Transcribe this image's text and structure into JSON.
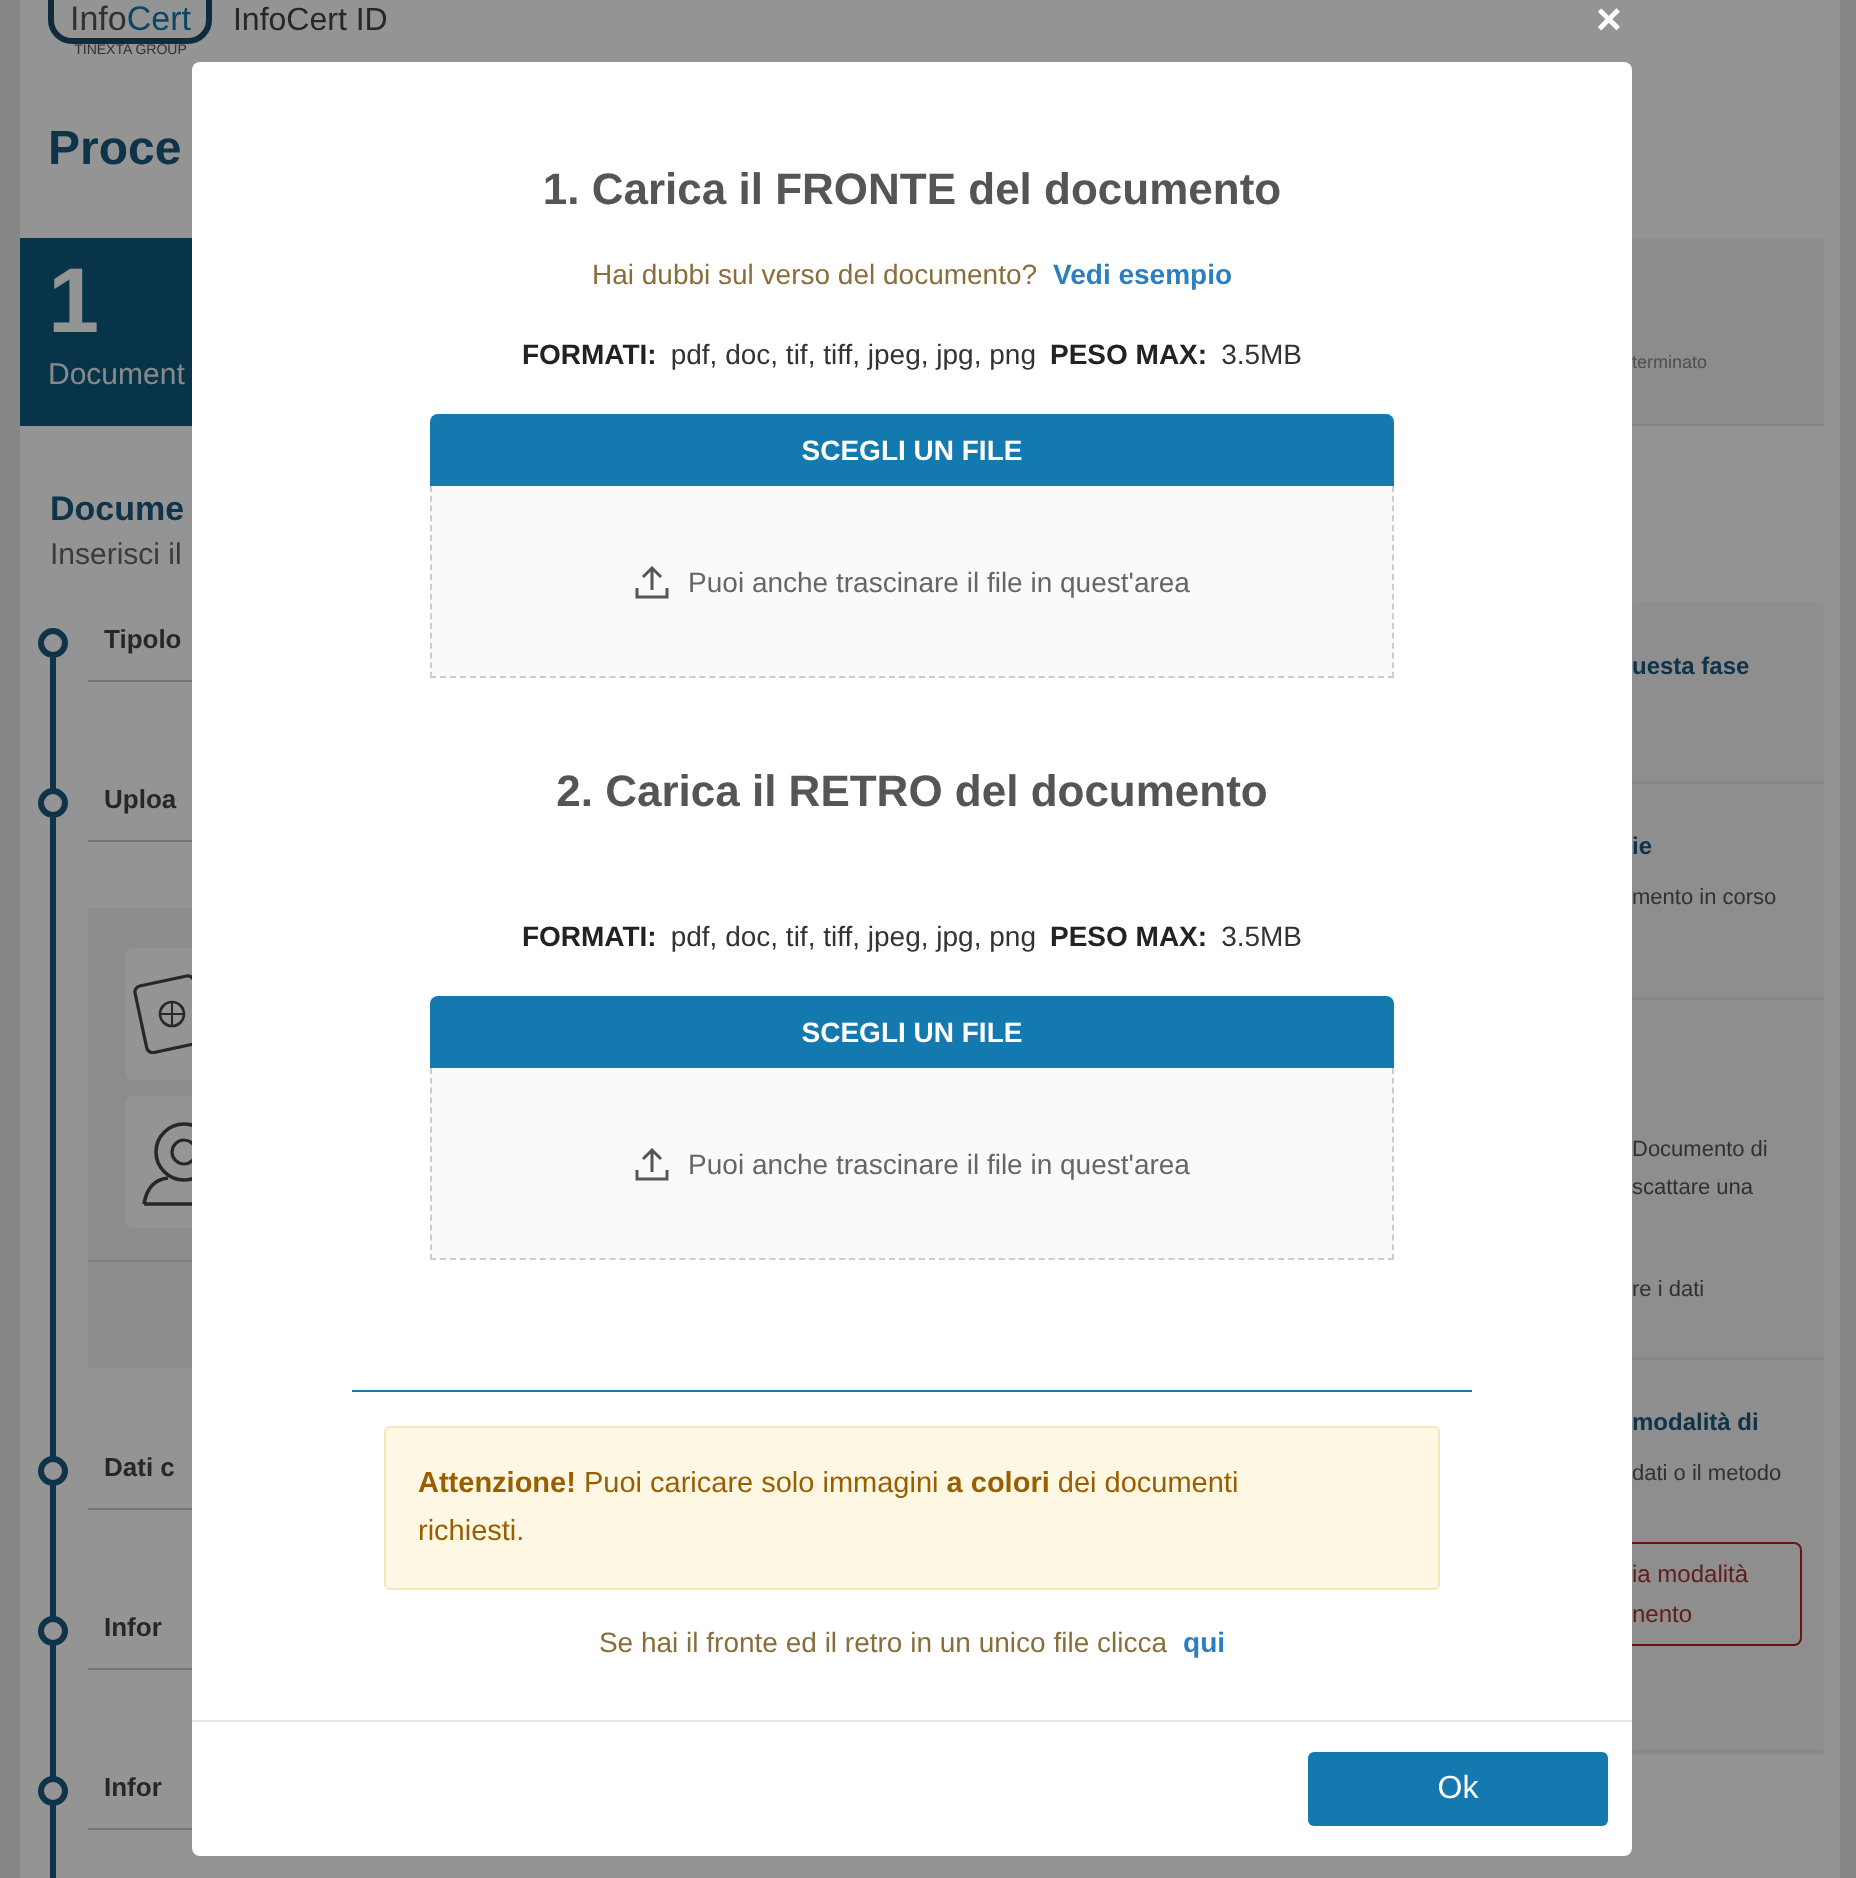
{
  "header": {
    "brand_parts": [
      "Info",
      "Cert"
    ],
    "brand_sub": "TINEXTA GROUP",
    "title": "InfoCert ID"
  },
  "page": {
    "heading": "Proce",
    "step": {
      "number": "1",
      "label": "Document",
      "selected": true
    },
    "step_note": "terminato",
    "section_title": "Docume",
    "section_subtitle": "Inserisci il",
    "timeline_top": [
      {
        "label": "Tipolo"
      },
      {
        "label": "Uploa"
      }
    ],
    "timeline_bottom": [
      {
        "label": "Dati c"
      },
      {
        "label": "Infor"
      },
      {
        "label": "Infor"
      }
    ]
  },
  "side_panel": {
    "sections": [
      {
        "title": "uesta fase"
      },
      {
        "title": "ie",
        "paragraphs": [
          [
            "mento in corso"
          ]
        ]
      },
      {
        "paragraphs": [
          [
            "Documento di",
            "scattare una"
          ],
          [
            "re i dati"
          ]
        ]
      },
      {
        "title": "modalità di",
        "paragraphs": [
          [
            "dati o il metodo"
          ]
        ],
        "button": [
          "ia modalità",
          "nento"
        ]
      }
    ]
  },
  "dialog": {
    "close": "×",
    "sections": [
      {
        "title": "1. Carica il FRONTE del documento",
        "hint": "Hai dubbi sul verso del documento?",
        "hint_link": "Vedi esempio",
        "formats": {
          "label": "FORMATI:",
          "value": "pdf, doc, tif, tiff, jpeg, jpg, png",
          "size_label": "PESO MAX:",
          "size_value": "3.5MB"
        },
        "button": "SCEGLI UN FILE",
        "drop_text": "Puoi anche trascinare il file in quest'area"
      },
      {
        "title": "2. Carica il RETRO del documento",
        "formats": {
          "label": "FORMATI:",
          "value": "pdf, doc, tif, tiff, jpeg, jpg, png",
          "size_label": "PESO MAX:",
          "size_value": "3.5MB"
        },
        "button": "SCEGLI UN FILE",
        "drop_text": "Puoi anche trascinare il file in quest'area"
      }
    ],
    "alert": "**Attenzione!** Puoi caricare solo immagini **a colori** dei documenti richiesti.",
    "footer_text": "Se hai il fronte ed il retro in un unico file clicca",
    "footer_link": "qui",
    "ok": "Ok"
  }
}
